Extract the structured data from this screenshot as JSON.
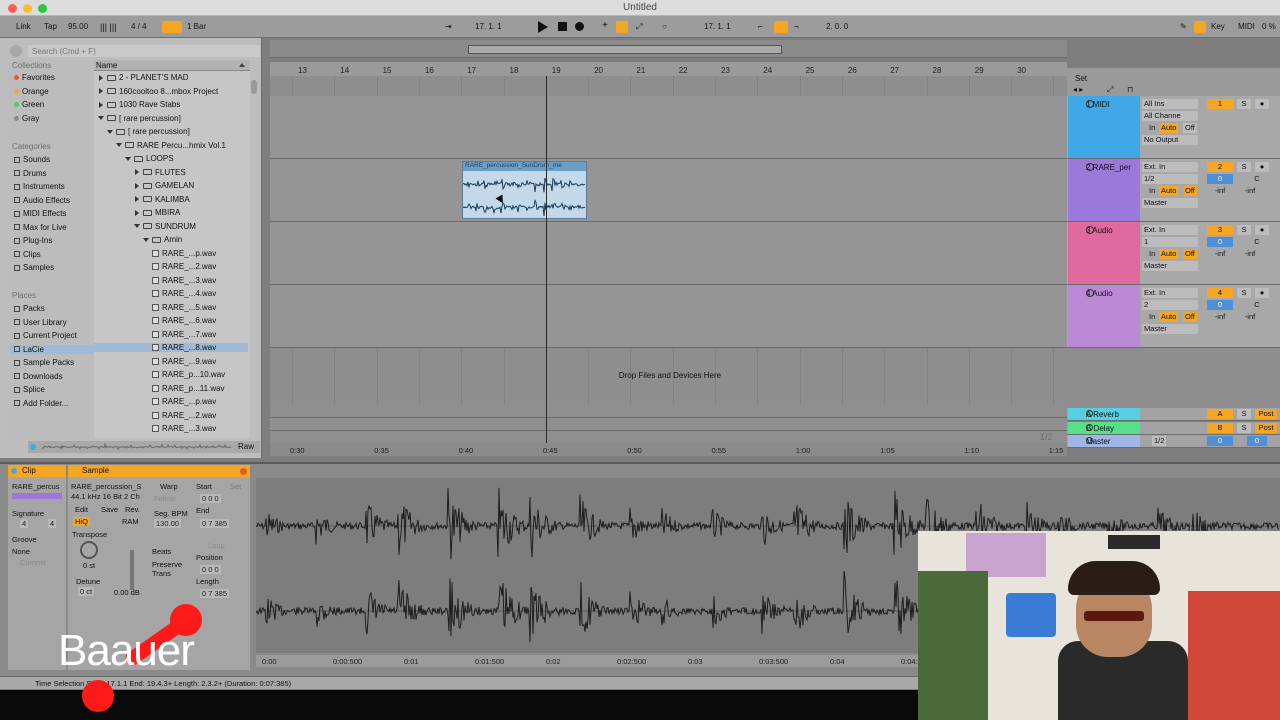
{
  "window": {
    "title": "Untitled"
  },
  "controlbar": {
    "link": "Link",
    "tap": "Tap",
    "tempo": "95.00",
    "signature": "4 / 4",
    "quantize": "1 Bar",
    "position": "17.  1.  1",
    "loop_start": "17.  1.  1",
    "loop_length": "2.  0.  0",
    "key": "Key",
    "midi": "MIDI",
    "cpu": "0 %",
    "colors": {
      "accent": "#f5a623"
    }
  },
  "browser": {
    "search_placeholder": "Search (Cmd + F)",
    "collections_header": "Collections",
    "collections": [
      {
        "label": "Favorites",
        "color": "#e05d2b"
      },
      {
        "label": "Orange",
        "color": "#f5a623"
      },
      {
        "label": "Green",
        "color": "#4ccf57"
      },
      {
        "label": "Gray",
        "color": "#8a8a8a"
      }
    ],
    "categories_header": "Categories",
    "categories": [
      "Sounds",
      "Drums",
      "Instruments",
      "Audio Effects",
      "MIDI Effects",
      "Max for Live",
      "Plug-Ins",
      "Clips",
      "Samples"
    ],
    "places_header": "Places",
    "places": [
      "Packs",
      "User Library",
      "Current Project",
      "LaCie",
      "Sample Packs",
      "Downloads",
      "Splice",
      "Add Folder..."
    ],
    "name_header": "Name",
    "files": [
      {
        "label": "2 - PLANET'S MAD",
        "type": "folder",
        "indent": 0
      },
      {
        "label": "160cooltoo 8...mbox Project",
        "type": "folder",
        "indent": 0
      },
      {
        "label": "1030 Rave Stabs",
        "type": "folder",
        "indent": 0
      },
      {
        "label": "[ rare percussion]",
        "type": "folder-open",
        "indent": 0
      },
      {
        "label": "[ rare percussion]",
        "type": "folder-open",
        "indent": 1
      },
      {
        "label": "RARE Percu...hmix Vol.1",
        "type": "folder-open",
        "indent": 2
      },
      {
        "label": "LOOPS",
        "type": "folder-open",
        "indent": 3
      },
      {
        "label": "FLUTES",
        "type": "folder",
        "indent": 4
      },
      {
        "label": "GAMELAN",
        "type": "folder",
        "indent": 4
      },
      {
        "label": "KALIMBA",
        "type": "folder",
        "indent": 4
      },
      {
        "label": "MBIRA",
        "type": "folder",
        "indent": 4
      },
      {
        "label": "SUNDRUM",
        "type": "folder-open",
        "indent": 4
      },
      {
        "label": "Amin",
        "type": "folder-open",
        "indent": 5
      },
      {
        "label": "RARE_...p.wav",
        "type": "wav",
        "indent": 6
      },
      {
        "label": "RARE_...2.wav",
        "type": "wav",
        "indent": 6
      },
      {
        "label": "RARE_...3.wav",
        "type": "wav",
        "indent": 6
      },
      {
        "label": "RARE_...4.wav",
        "type": "wav",
        "indent": 6
      },
      {
        "label": "RARE_...5.wav",
        "type": "wav",
        "indent": 6
      },
      {
        "label": "RARE_...6.wav",
        "type": "wav",
        "indent": 6
      },
      {
        "label": "RARE_...7.wav",
        "type": "wav",
        "indent": 6
      },
      {
        "label": "RARE_...8.wav",
        "type": "wav",
        "indent": 6,
        "selected": true
      },
      {
        "label": "RARE_...9.wav",
        "type": "wav",
        "indent": 6
      },
      {
        "label": "RARE_p...10.wav",
        "type": "wav",
        "indent": 6
      },
      {
        "label": "RARE_p...11.wav",
        "type": "wav",
        "indent": 6
      },
      {
        "label": "RARE_...p.wav",
        "type": "wav",
        "indent": 6
      },
      {
        "label": "RARE_...2.wav",
        "type": "wav",
        "indent": 6
      },
      {
        "label": "RARE_...3.wav",
        "type": "wav",
        "indent": 6
      }
    ],
    "raw": "Raw"
  },
  "arrangement": {
    "ruler": [
      "13",
      "14",
      "15",
      "16",
      "17",
      "18",
      "19",
      "20",
      "21",
      "22",
      "23",
      "24",
      "25",
      "26",
      "27",
      "28",
      "29",
      "30"
    ],
    "clip_name": "RARE_percussion_SunDrum_me",
    "drop_text": "Drop Files and Devices Here",
    "timeline": [
      "0:30",
      "0:35",
      "0:40",
      "0:45",
      "0:50",
      "0:55",
      "1:00",
      "1:05",
      "1:10",
      "1:15"
    ],
    "set_label": "Set",
    "fraction": "1/2"
  },
  "tracks": [
    {
      "name": "1 MIDI",
      "color": "#3fa9e8",
      "input": "All Ins",
      "channel": "All Channe",
      "output": "No Output",
      "number": "1",
      "monitor": "Auto"
    },
    {
      "name": "2 RARE_per",
      "color": "#9b79db",
      "input": "Ext. In",
      "channel": "1/2",
      "output": "Master",
      "number": "2",
      "monitor": "Auto",
      "vol": "0",
      "pan": "C",
      "sendA": "-inf",
      "sendB": "-inf"
    },
    {
      "name": "3 Audio",
      "color": "#e06aa0",
      "input": "Ext. In",
      "channel": "1",
      "output": "Master",
      "number": "3",
      "monitor": "Auto",
      "vol": "0",
      "pan": "C",
      "sendA": "-inf",
      "sendB": "-inf"
    },
    {
      "name": "4 Audio",
      "color": "#bb8ad6",
      "input": "Ext. In",
      "channel": "2",
      "output": "Master",
      "number": "4",
      "monitor": "Auto",
      "vol": "0",
      "pan": "C",
      "sendA": "-inf",
      "sendB": "-inf"
    }
  ],
  "returns": [
    {
      "name": "A Reverb",
      "color": "#56cfe0",
      "letter": "A",
      "post": "Post"
    },
    {
      "name": "B Delay",
      "color": "#56e08c",
      "letter": "B",
      "post": "Post"
    },
    {
      "name": "Master",
      "color": "#9fb6e6",
      "fraction": "1/2",
      "vol": "0",
      "pan": "0"
    }
  ],
  "detail": {
    "clip_head": "Clip",
    "clip_name": "RARE_percus",
    "signature_label": "Signature",
    "sig_num": "4",
    "sig_den": "4",
    "groove_label": "Groove",
    "groove_val": "None",
    "commit": "Commit",
    "sample_head": "Sample",
    "sample_name": "RARE_percussion_S",
    "sample_info": "44.1 kHz 16 Bit 2 Ch",
    "edit": "Edit",
    "save": "Save",
    "rev": "Rev.",
    "hiq": "HiQ",
    "ram": "RAM",
    "transpose_label": "Transpose",
    "transpose_val": "0 st",
    "detune_label": "Detune",
    "detune_val": "0 ct",
    "gain_val": "0.00 dB",
    "warp": "Warp",
    "follow": "Follow",
    "seg_bpm_label": "Seg. BPM",
    "seg_bpm_val": "130.00",
    "beats": "Beats",
    "preserve": "Preserve",
    "trans": "Trans",
    "start_label": "Start",
    "start_val": "0  0  0",
    "end_label": "End",
    "end_val": "0  7  385",
    "loop_label": "Loop",
    "position_label": "Position",
    "position_val": "0  0  0",
    "length_label": "Length",
    "length_val": "0  7  385",
    "set": "Set",
    "wave_ruler": [
      "0:00",
      "0:00:500",
      "0:01",
      "0:01:500",
      "0:02",
      "0:02:500",
      "0:03",
      "0:03:500",
      "0:04",
      "0:04:500"
    ]
  },
  "status": {
    "text": "Time Selection    Start: 17.1.1    End: 19.4.3+    Length: 2.3.2+  (Duration: 0:07:385)"
  },
  "overlay": {
    "logo": "Baauer"
  }
}
